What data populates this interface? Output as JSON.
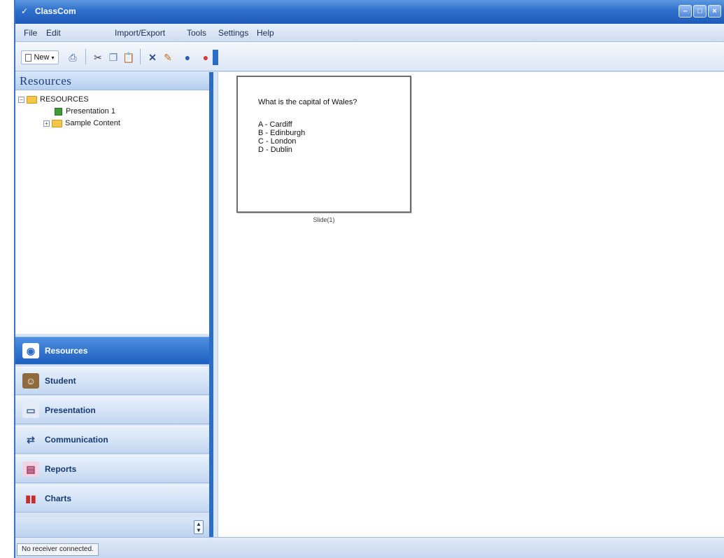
{
  "window": {
    "title": "ClassCom"
  },
  "menu": [
    "File",
    "Edit",
    "Import/Export",
    "Tools",
    "Settings",
    "Help"
  ],
  "toolbar": {
    "new_label": "New"
  },
  "resources": {
    "header": "Resources",
    "tree": [
      {
        "label": "RESOURCES",
        "expander": "−"
      },
      {
        "label": "Presentation 1"
      },
      {
        "label": "Sample Content",
        "expander": "+"
      }
    ]
  },
  "nav": [
    {
      "label": "Resources",
      "icon": "resources-icon",
      "active": true
    },
    {
      "label": "Student",
      "icon": "student-icon"
    },
    {
      "label": "Presentation",
      "icon": "presentation-icon"
    },
    {
      "label": "Communication",
      "icon": "communication-icon"
    },
    {
      "label": "Reports",
      "icon": "reports-icon"
    },
    {
      "label": "Charts",
      "icon": "charts-icon"
    }
  ],
  "slide": {
    "question": "What is the capital of Wales?",
    "answers": [
      "A - Cardiff",
      "B - Edinburgh",
      "C - London",
      "D - Dublin"
    ],
    "caption": "Slide(1)"
  },
  "status": {
    "text": "No receiver connected."
  },
  "colors": {
    "accent": "#2c6cc9",
    "active_nav": "#1f5fbf"
  }
}
